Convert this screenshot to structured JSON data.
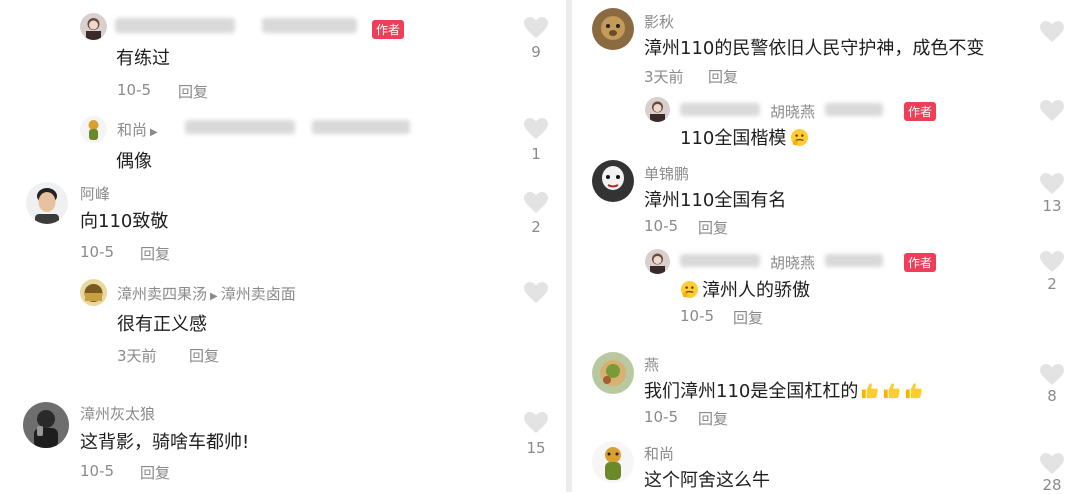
{
  "left": [
    {
      "text": "有练过",
      "time": "10-5",
      "reply": "回复",
      "likes": "9",
      "author_tag": "作者"
    },
    {
      "name": "和尚",
      "text": "偶像",
      "likes": "1"
    },
    {
      "name": "阿峰",
      "text": "向110致敬",
      "time": "10-5",
      "reply": "回复",
      "likes": "2"
    },
    {
      "name": "漳州卖四果汤",
      "target": "漳州卖卤面",
      "text": "很有正义感",
      "time": "3天前",
      "reply": "回复"
    },
    {
      "name": "漳州灰太狼",
      "text": "这背影，骑啥车都帅!",
      "time": "10-5",
      "reply": "回复",
      "likes": "15"
    }
  ],
  "right": [
    {
      "name": "影秋",
      "text": "漳州110的民警依旧人民守护神，成色不变",
      "time": "3天前",
      "reply": "回复"
    },
    {
      "name_visible": "胡晓燕",
      "text": "110全国楷模",
      "author_tag": "作者"
    },
    {
      "name": "单锦鹏",
      "text": "漳州110全国有名",
      "time": "10-5",
      "reply": "回复",
      "likes": "13"
    },
    {
      "name_visible": "胡晓燕",
      "text": "漳州人的骄傲",
      "time": "10-5",
      "reply": "回复",
      "likes": "2",
      "author_tag": "作者"
    },
    {
      "name": "燕",
      "text": "我们漳州110是全国杠杠的",
      "time": "10-5",
      "reply": "回复",
      "likes": "8"
    },
    {
      "name": "和尚",
      "text": "这个阿舍这么牛",
      "likes": "28"
    }
  ],
  "colors": {
    "tag": "#f03e58",
    "meta": "#8a8a8a",
    "heart": "#e3e3e3"
  }
}
